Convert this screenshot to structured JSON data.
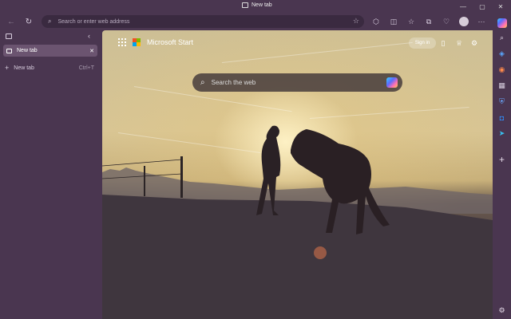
{
  "window": {
    "title": "New tab",
    "controls": [
      "minimize",
      "maximize",
      "close"
    ]
  },
  "toolbar": {
    "address_placeholder": "Search or enter web address"
  },
  "vertical_tabs": {
    "tabs": [
      {
        "label": "New tab"
      }
    ],
    "new_tab": {
      "label": "New tab",
      "shortcut": "Ctrl+T"
    }
  },
  "start_page": {
    "brand": "Microsoft Start",
    "signin_label": "Sign in",
    "search_placeholder": "Search the web"
  },
  "colors": {
    "chrome": "#4a3650",
    "address_bg": "#3a2a40",
    "active_tab": "#6b5470",
    "ms_red": "#f25022",
    "ms_green": "#7fba00",
    "ms_blue": "#00a4ef",
    "ms_yellow": "#ffb900"
  },
  "icons": {
    "titlebar": [
      "tab-icon"
    ],
    "toolbar": [
      "back-icon",
      "refresh-icon",
      "info-icon",
      "favorite-star-icon",
      "extensions-icon",
      "split-screen-icon",
      "favorites-icon",
      "collections-icon",
      "browser-essentials-icon",
      "profile-icon",
      "more-icon"
    ],
    "sidebar": [
      "copilot-icon",
      "search-icon",
      "shopping-icon",
      "games-icon",
      "office-icon",
      "security-icon",
      "outlook-icon",
      "drop-icon",
      "add-icon",
      "settings-icon"
    ]
  }
}
